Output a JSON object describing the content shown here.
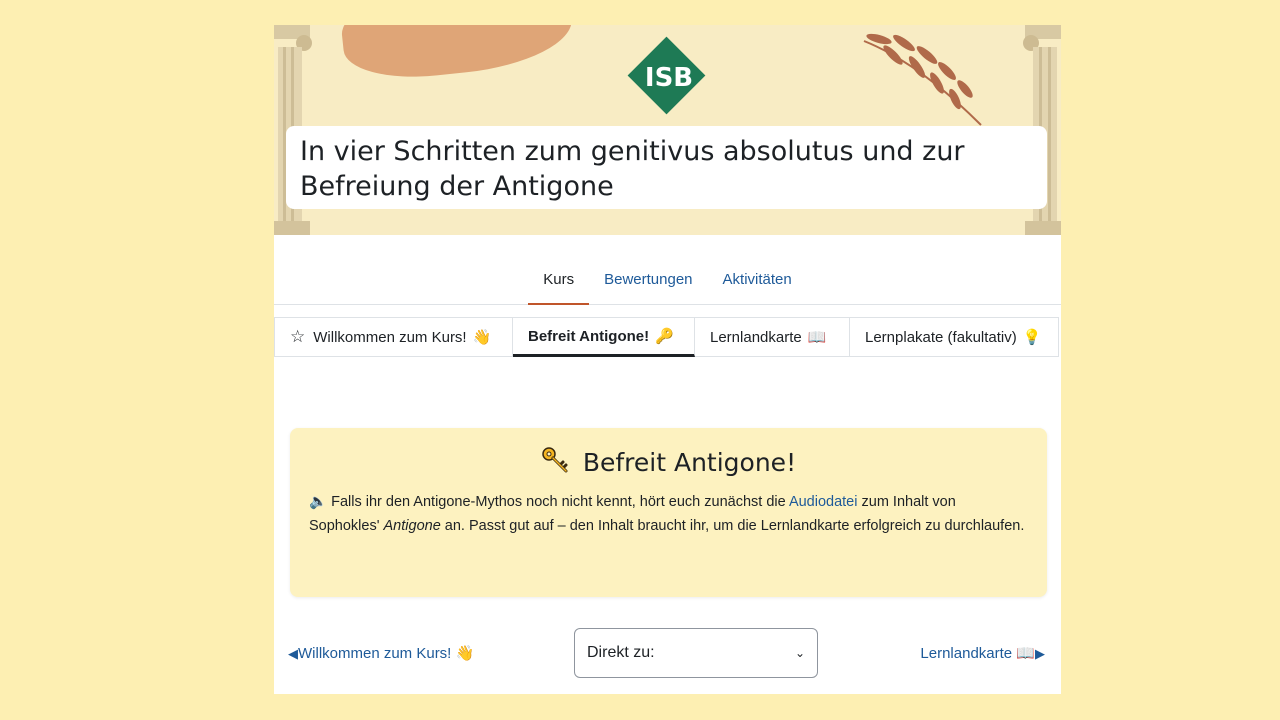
{
  "header": {
    "logo_text": "ISB",
    "title": "In vier Schritten zum genitivus absolutus und zur Befreiung der Antigone"
  },
  "nav": {
    "items": [
      {
        "label": "Kurs",
        "active": true
      },
      {
        "label": "Bewertungen",
        "active": false
      },
      {
        "label": "Aktivitäten",
        "active": false
      }
    ]
  },
  "tabs": {
    "items": [
      {
        "label": "Willkommen zum Kurs!",
        "emoji": "👋"
      },
      {
        "label": "Befreit Antigone!",
        "emoji": "🔑"
      },
      {
        "label": "Lernlandkarte",
        "emoji": "📖"
      },
      {
        "label": "Lernplakate (fakultativ)",
        "emoji": "💡"
      }
    ]
  },
  "section": {
    "title": "Befreit Antigone!",
    "speaker": "🔈",
    "text_1": "Falls ihr den Antigone-Mythos noch nicht kennt, hört euch zunächst die",
    "link": "Audiodatei",
    "text_2": "zum Inhalt von Sophokles'",
    "em": "Antigone",
    "text_3": "an. Passt gut auf – den Inhalt braucht ihr, um die Lernlandkarte erfolgreich zu durchlaufen."
  },
  "footer": {
    "prev_label": "Willkommen zum Kurs!",
    "prev_emoji": "👋",
    "jump_label": "Direkt zu:",
    "next_label": "Lernlandkarte",
    "next_emoji": "📖"
  },
  "colors": {
    "background": "#fdefb2",
    "banner": "#f8ecc4",
    "accent_blob": "#dfa577",
    "logo": "#1e7a55",
    "link": "#1e5a99",
    "card": "#fdf2c0",
    "active_nav_underline": "#c0552a"
  }
}
